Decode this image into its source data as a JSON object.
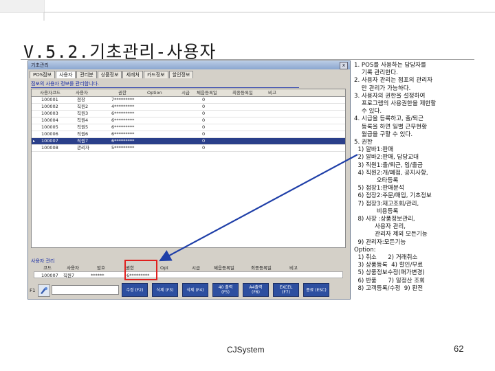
{
  "slide": {
    "title": "V.5.2.기초관리-사용자",
    "footer": "CJSystem",
    "page_number": "62"
  },
  "window": {
    "title": "기초관리",
    "close_label": "x",
    "tabs": [
      "POS점보",
      "사용자",
      "관리분",
      "상품정보",
      "세례처",
      "카드정보",
      "할인정보"
    ],
    "active_tab": 1,
    "section_title": "점포의 사용자 정보를 관리합니다.",
    "columns": [
      "사용자코드",
      "사용자",
      "권한",
      "Option",
      "시급",
      "체음등록일",
      "최종등록일",
      "비고"
    ],
    "rows": [
      [
        "100001",
        "점장",
        "7*********",
        "0"
      ],
      [
        "100002",
        "직원2",
        "4*********",
        "0"
      ],
      [
        "100003",
        "직원3",
        "6*********",
        "0"
      ],
      [
        "100004",
        "직원4",
        "6*********",
        "0"
      ],
      [
        "100005",
        "직원5",
        "6*********",
        "0"
      ],
      [
        "100006",
        "직원6",
        "6*********",
        "0"
      ],
      [
        "100007",
        "직원7",
        "6*********",
        "0"
      ],
      [
        "100008",
        "관리자",
        "5*********",
        "0"
      ]
    ],
    "selected_row": 6,
    "detail_title": "사용자 관리",
    "detail_columns": [
      "코드",
      "사용자",
      "암호",
      "권한",
      "Opt",
      "시급",
      "체음등록일",
      "최종등록일",
      "비고"
    ],
    "detail_values": [
      "100007",
      "직원7",
      "******",
      "6*********"
    ],
    "f1_label": "F1",
    "buttons": [
      {
        "line1": "수정 (F2)",
        "line2": ""
      },
      {
        "line1": "삭제 (F3)",
        "line2": ""
      },
      {
        "line1": "삭제 (F4)",
        "line2": ""
      },
      {
        "line1": "40 출력",
        "line2": "(F5)"
      },
      {
        "line1": "A4출력",
        "line2": "(F6)"
      },
      {
        "line1": "EXCEL",
        "line2": "(F7)"
      },
      {
        "line1": "종료 (ESC)",
        "line2": ""
      }
    ]
  },
  "notes": [
    "1. POS를 사용하는 담당자를",
    "    기록 관리한다.",
    "2. 사용자 관리는 점포의 관리자",
    "    만 관리가 가능하다.",
    "3. 사용자의 권한을 설정하여",
    "    프로그램의 사용권한을 제한할",
    "    수 있다.",
    "4. 시급을 등록하고, 출/퇴근",
    "    등록을 하면 일별 근무현황",
    "    월급을 구할 수 있다.",
    "5. 권한",
    "  1) 알바1:판매",
    "  2) 알바2:판매, 담당교대",
    "  3) 직원1:출/퇴근, 입/출금",
    "  4) 직원2:개/폐점, 공지사항,",
    "            오타등록",
    "  5) 점장1:판매분석",
    "  6) 점장2:주문/매입, 기초정보",
    "  7) 점장3:재고조회/관리,",
    "            비용등록",
    "  8) 사장 :상품정보관리,",
    "           사용자 관리,",
    "           관리자 제외 모든기능",
    "  9) 관리자:모든기능",
    "Option:",
    "  1) 취소      2) 거래취소",
    "  3) 상품등록  4) 할인/무료",
    "  5) 상품정보수정(매가변경)",
    "  6) 반품      7) 일정산 조회",
    "  8) 고객등록/수정  9) 환전"
  ],
  "colors": {
    "accent": "#2d4fa0",
    "highlight": "#e0201e",
    "arrow": "#1f3fa8"
  }
}
